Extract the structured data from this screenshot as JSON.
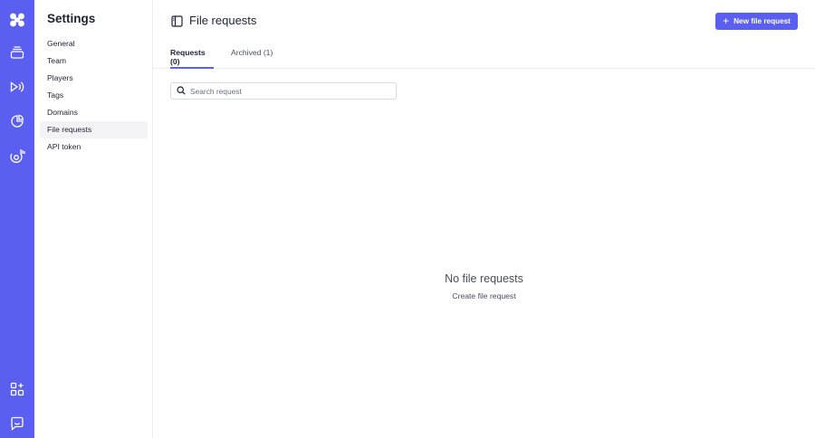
{
  "colors": {
    "accent": "#5a5ff0",
    "rail_bg": "#5a5ff0",
    "active_item_bg": "#f3f3f6",
    "text": "#1f2233",
    "muted": "#4a4d5e"
  },
  "rail": {
    "icons": [
      "logo-icon",
      "media-icon",
      "broadcast-icon",
      "analytics-icon",
      "apps-icon",
      "integrations-icon",
      "support-chat-icon"
    ]
  },
  "sidebar": {
    "title": "Settings",
    "items": [
      {
        "label": "General"
      },
      {
        "label": "Team"
      },
      {
        "label": "Players"
      },
      {
        "label": "Tags"
      },
      {
        "label": "Domains"
      },
      {
        "label": "File requests",
        "active": true
      },
      {
        "label": "API token"
      }
    ]
  },
  "header": {
    "title": "File requests",
    "new_button_label": "New file request"
  },
  "tabs": [
    {
      "label": "Requests (0)",
      "active": true
    },
    {
      "label": "Archived (1)",
      "active": false
    }
  ],
  "search": {
    "placeholder": "Search request",
    "value": ""
  },
  "empty_state": {
    "title": "No file requests",
    "action_label": "Create file request"
  }
}
